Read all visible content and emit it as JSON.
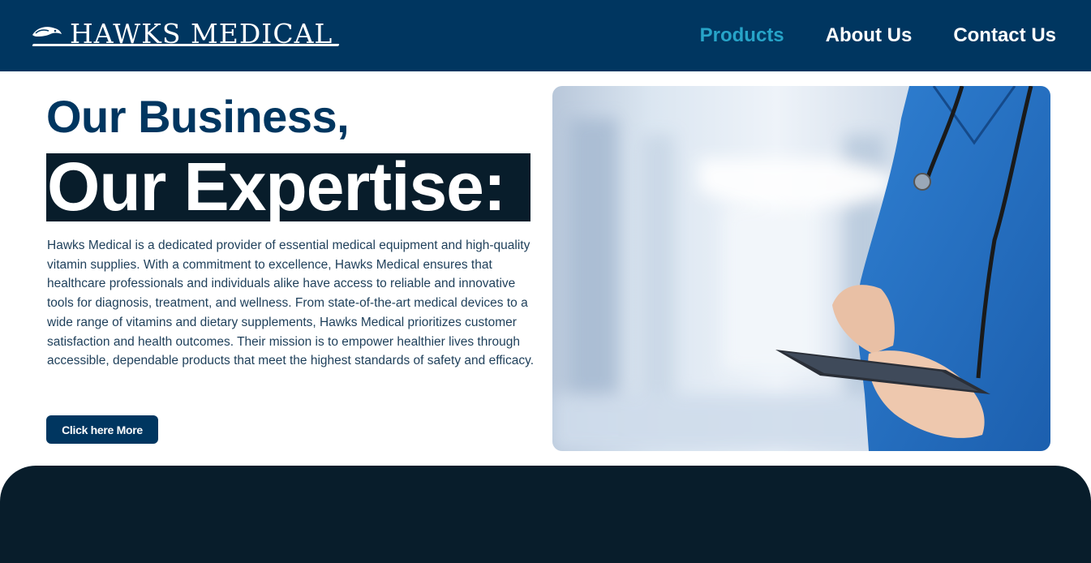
{
  "header": {
    "logo_text": "HAWKS MEDICAL",
    "nav": [
      {
        "label": "Products",
        "active": true
      },
      {
        "label": "About Us",
        "active": false
      },
      {
        "label": "Contact Us",
        "active": false
      }
    ]
  },
  "hero": {
    "title_line1": "Our Business,",
    "title_line2": "Our Expertise:",
    "description": "Hawks Medical is a dedicated provider of essential medical equipment and high-quality vitamin supplies. With a commitment to excellence, Hawks Medical ensures that healthcare professionals and individuals alike have access to reliable and innovative tools for diagnosis, treatment, and wellness. From state-of-the-art medical devices to a wide range of vitamins and dietary supplements, Hawks Medical prioritizes customer satisfaction and health outcomes. Their mission is to empower healthier lives through accessible, dependable products that meet the highest standards of safety and efficacy.",
    "cta_label": "Click here More"
  },
  "colors": {
    "header_bg": "#003660",
    "nav_active": "#27a4c8",
    "dark_band": "#081d2b"
  },
  "icons": {
    "logo_mark": "hawk-icon"
  }
}
